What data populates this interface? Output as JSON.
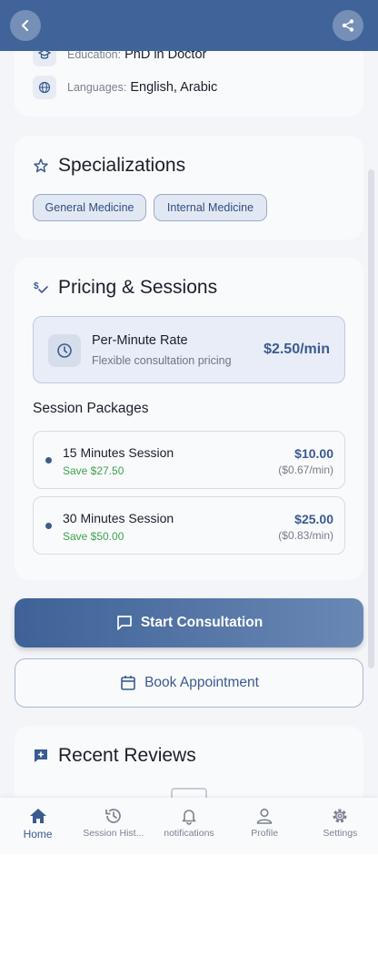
{
  "profile_details": {
    "education_label": "Education:",
    "education_value": "PhD in Doctor",
    "languages_label": "Languages:",
    "languages_value": "English, Arabic"
  },
  "specializations": {
    "title": "Specializations",
    "chips": [
      "General Medicine",
      "Internal Medicine"
    ]
  },
  "pricing": {
    "title": "Pricing & Sessions",
    "rate_title": "Per-Minute Rate",
    "rate_subtitle": "Flexible consultation pricing",
    "rate_value": "$2.50/min",
    "packages_title": "Session Packages",
    "packages": [
      {
        "name": "15 Minutes Session",
        "save": "Save $27.50",
        "price": "$10.00",
        "per_minute": "($0.67/min)"
      },
      {
        "name": "30 Minutes Session",
        "save": "Save $50.00",
        "price": "$25.00",
        "per_minute": "($0.83/min)"
      }
    ]
  },
  "actions": {
    "start_label": "Start Consultation",
    "book_label": "Book Appointment"
  },
  "reviews": {
    "title": "Recent Reviews"
  },
  "bottom_nav": [
    {
      "label": "Home",
      "icon": "home-icon",
      "active": true
    },
    {
      "label": "Session Hist...",
      "icon": "history-icon",
      "active": false
    },
    {
      "label": "notifications",
      "icon": "bell-icon",
      "active": false
    },
    {
      "label": "Profile",
      "icon": "person-icon",
      "active": false
    },
    {
      "label": "Settings",
      "icon": "gear-icon",
      "active": false
    }
  ],
  "colors": {
    "header": "#40649a",
    "accent": "#3b5b8f",
    "success": "#3fa34d",
    "background": "#f3f5f9"
  }
}
